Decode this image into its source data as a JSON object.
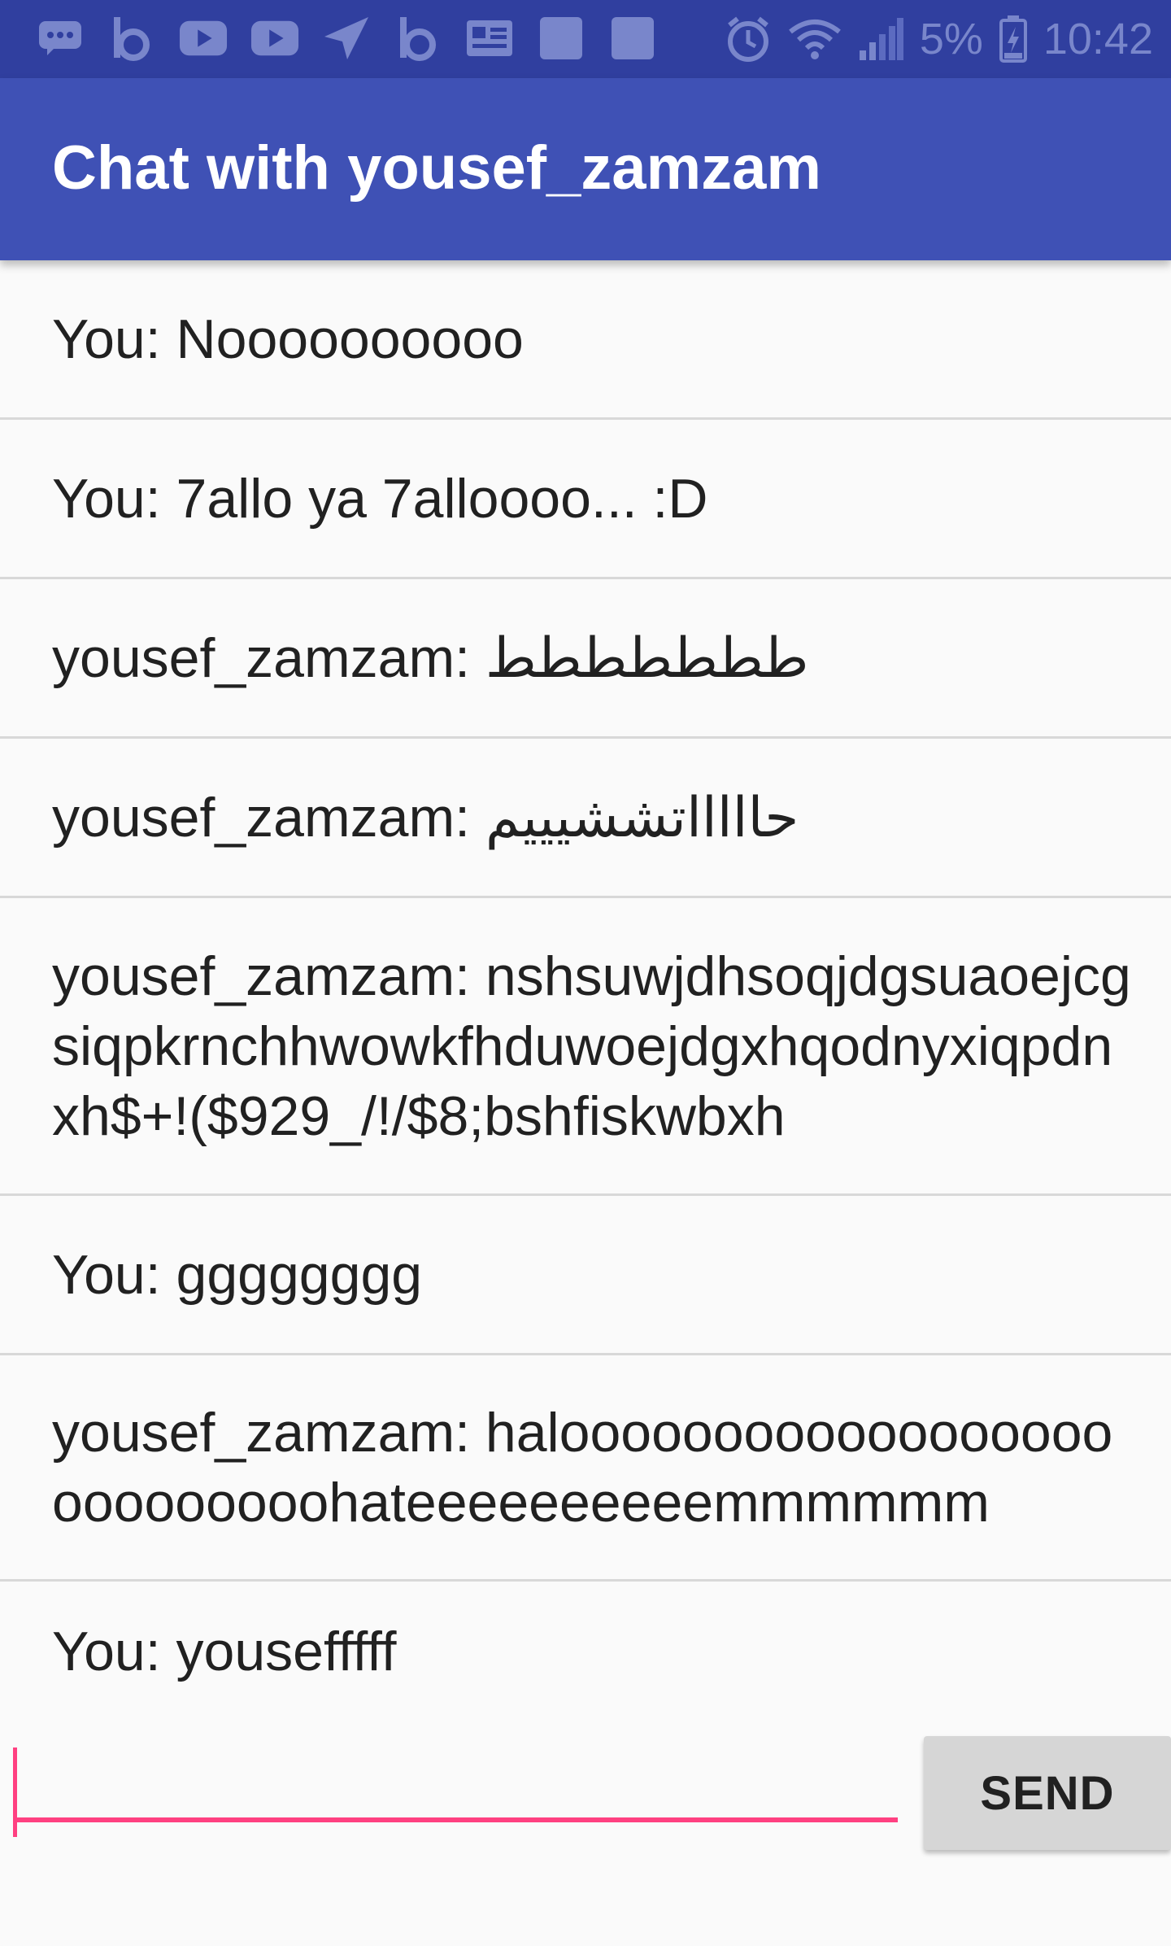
{
  "status_bar": {
    "battery": "5%",
    "time": "10:42",
    "icons": [
      "chat-icon",
      "b-app-icon",
      "youtube-icon",
      "youtube-icon",
      "send-arrow-icon",
      "b-app-icon",
      "news-icon",
      "square-app-icon",
      "square-app-icon",
      "alarm-icon",
      "wifi-icon",
      "signal-icon",
      "battery-charging-icon"
    ]
  },
  "app_bar": {
    "title": "Chat with yousef_zamzam"
  },
  "messages": [
    {
      "text": "You: Noooooooooo"
    },
    {
      "text": "You: 7allo ya 7alloooo... :D"
    },
    {
      "text": "yousef_zamzam: ططططططط"
    },
    {
      "text": "yousef_zamzam: حاااااتششيييم"
    },
    {
      "text": "yousef_zamzam: nshsuwjdhsoqjdgsuaoejcgsiqpkrnchhwowkfhduwoejdgxhqodnyxiqpdnxh$+!($929_/!/$8;bshfiskwbxh"
    },
    {
      "text": "You: gggggggg"
    },
    {
      "text": "yousef_zamzam: halooooooooooooooooooooooooooohateeeeeeeeeemmmmmm"
    },
    {
      "text": "You: yousefffff"
    }
  ],
  "composer": {
    "input_value": "",
    "input_placeholder": "",
    "send_label": "SEND"
  },
  "colors": {
    "status_bar": "#303f9f",
    "app_bar": "#3f51b5",
    "accent": "#ff4081"
  }
}
